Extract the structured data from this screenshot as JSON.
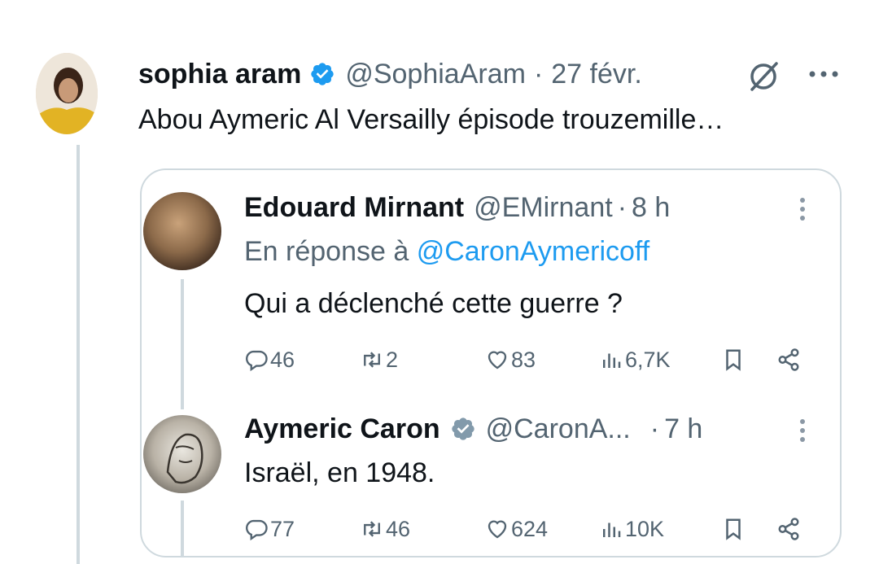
{
  "tweet": {
    "author_name": "sophia aram",
    "handle": "@SophiaAram",
    "separator": "·",
    "date": "27 févr.",
    "text": "Abou Aymeric Al Versailly épisode trouzemille…"
  },
  "quoted": [
    {
      "author_name": "Edouard Mirnant",
      "handle": "@EMirnant",
      "separator": "·",
      "time": "8 h",
      "reply_prefix": "En réponse à",
      "reply_to": "@CaronAymericoff",
      "text": "Qui a déclenché cette guerre ?",
      "stats": {
        "replies": "46",
        "reposts": "2",
        "likes": "83",
        "views": "6,7K"
      }
    },
    {
      "author_name": "Aymeric Caron",
      "handle": "@CaronA...",
      "separator": "·",
      "time": "7 h",
      "text": "Israël, en 1948.",
      "stats": {
        "replies": "77",
        "reposts": "46",
        "likes": "624",
        "views": "10K"
      }
    }
  ],
  "colors": {
    "verified": "#1d9bf0",
    "verified_gray": "#829aab",
    "link": "#1d9bf0",
    "muted": "#536471",
    "border": "#cfd9de"
  },
  "icons": [
    "verified-badge-icon",
    "grok-icon",
    "more-icon",
    "reply-icon",
    "repost-icon",
    "like-icon",
    "views-icon",
    "bookmark-icon",
    "share-icon"
  ]
}
